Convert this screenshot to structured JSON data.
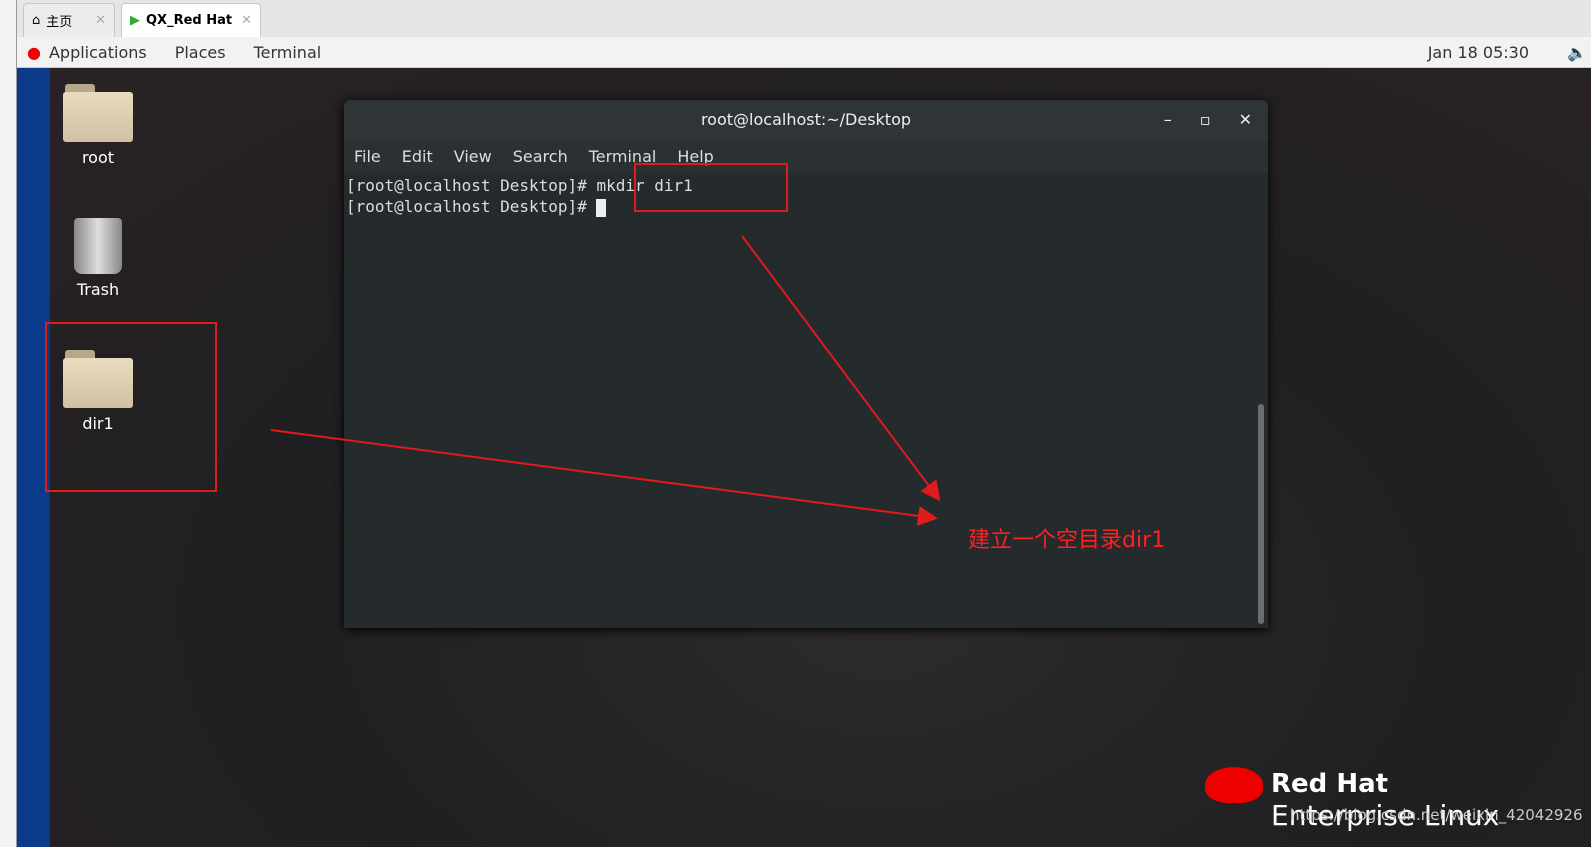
{
  "tabs": [
    {
      "label": "主页",
      "icon": "home-icon"
    },
    {
      "label": "QX_Red Hat",
      "icon": "vm-play-icon"
    }
  ],
  "topbar": {
    "items": [
      "Applications",
      "Places",
      "Terminal"
    ],
    "clock": "Jan 18  05:30"
  },
  "desktop_icons": [
    {
      "label": "root",
      "icon": "home-folder-icon"
    },
    {
      "label": "Trash",
      "icon": "trash-icon"
    },
    {
      "label": "dir1",
      "icon": "folder-icon"
    }
  ],
  "terminal": {
    "title": "root@localhost:~/Desktop",
    "menu": [
      "File",
      "Edit",
      "View",
      "Search",
      "Terminal",
      "Help"
    ],
    "lines": [
      "[root@localhost Desktop]# mkdir dir1",
      "[root@localhost Desktop]# "
    ]
  },
  "annotation": {
    "text": "建立一个空目录dir1",
    "color": "#e01b1b"
  },
  "logo": {
    "line1": "Red Hat",
    "line2": "Enterprise Linux"
  },
  "watermark": "https://blog.csdn.net/weixin_42042926"
}
